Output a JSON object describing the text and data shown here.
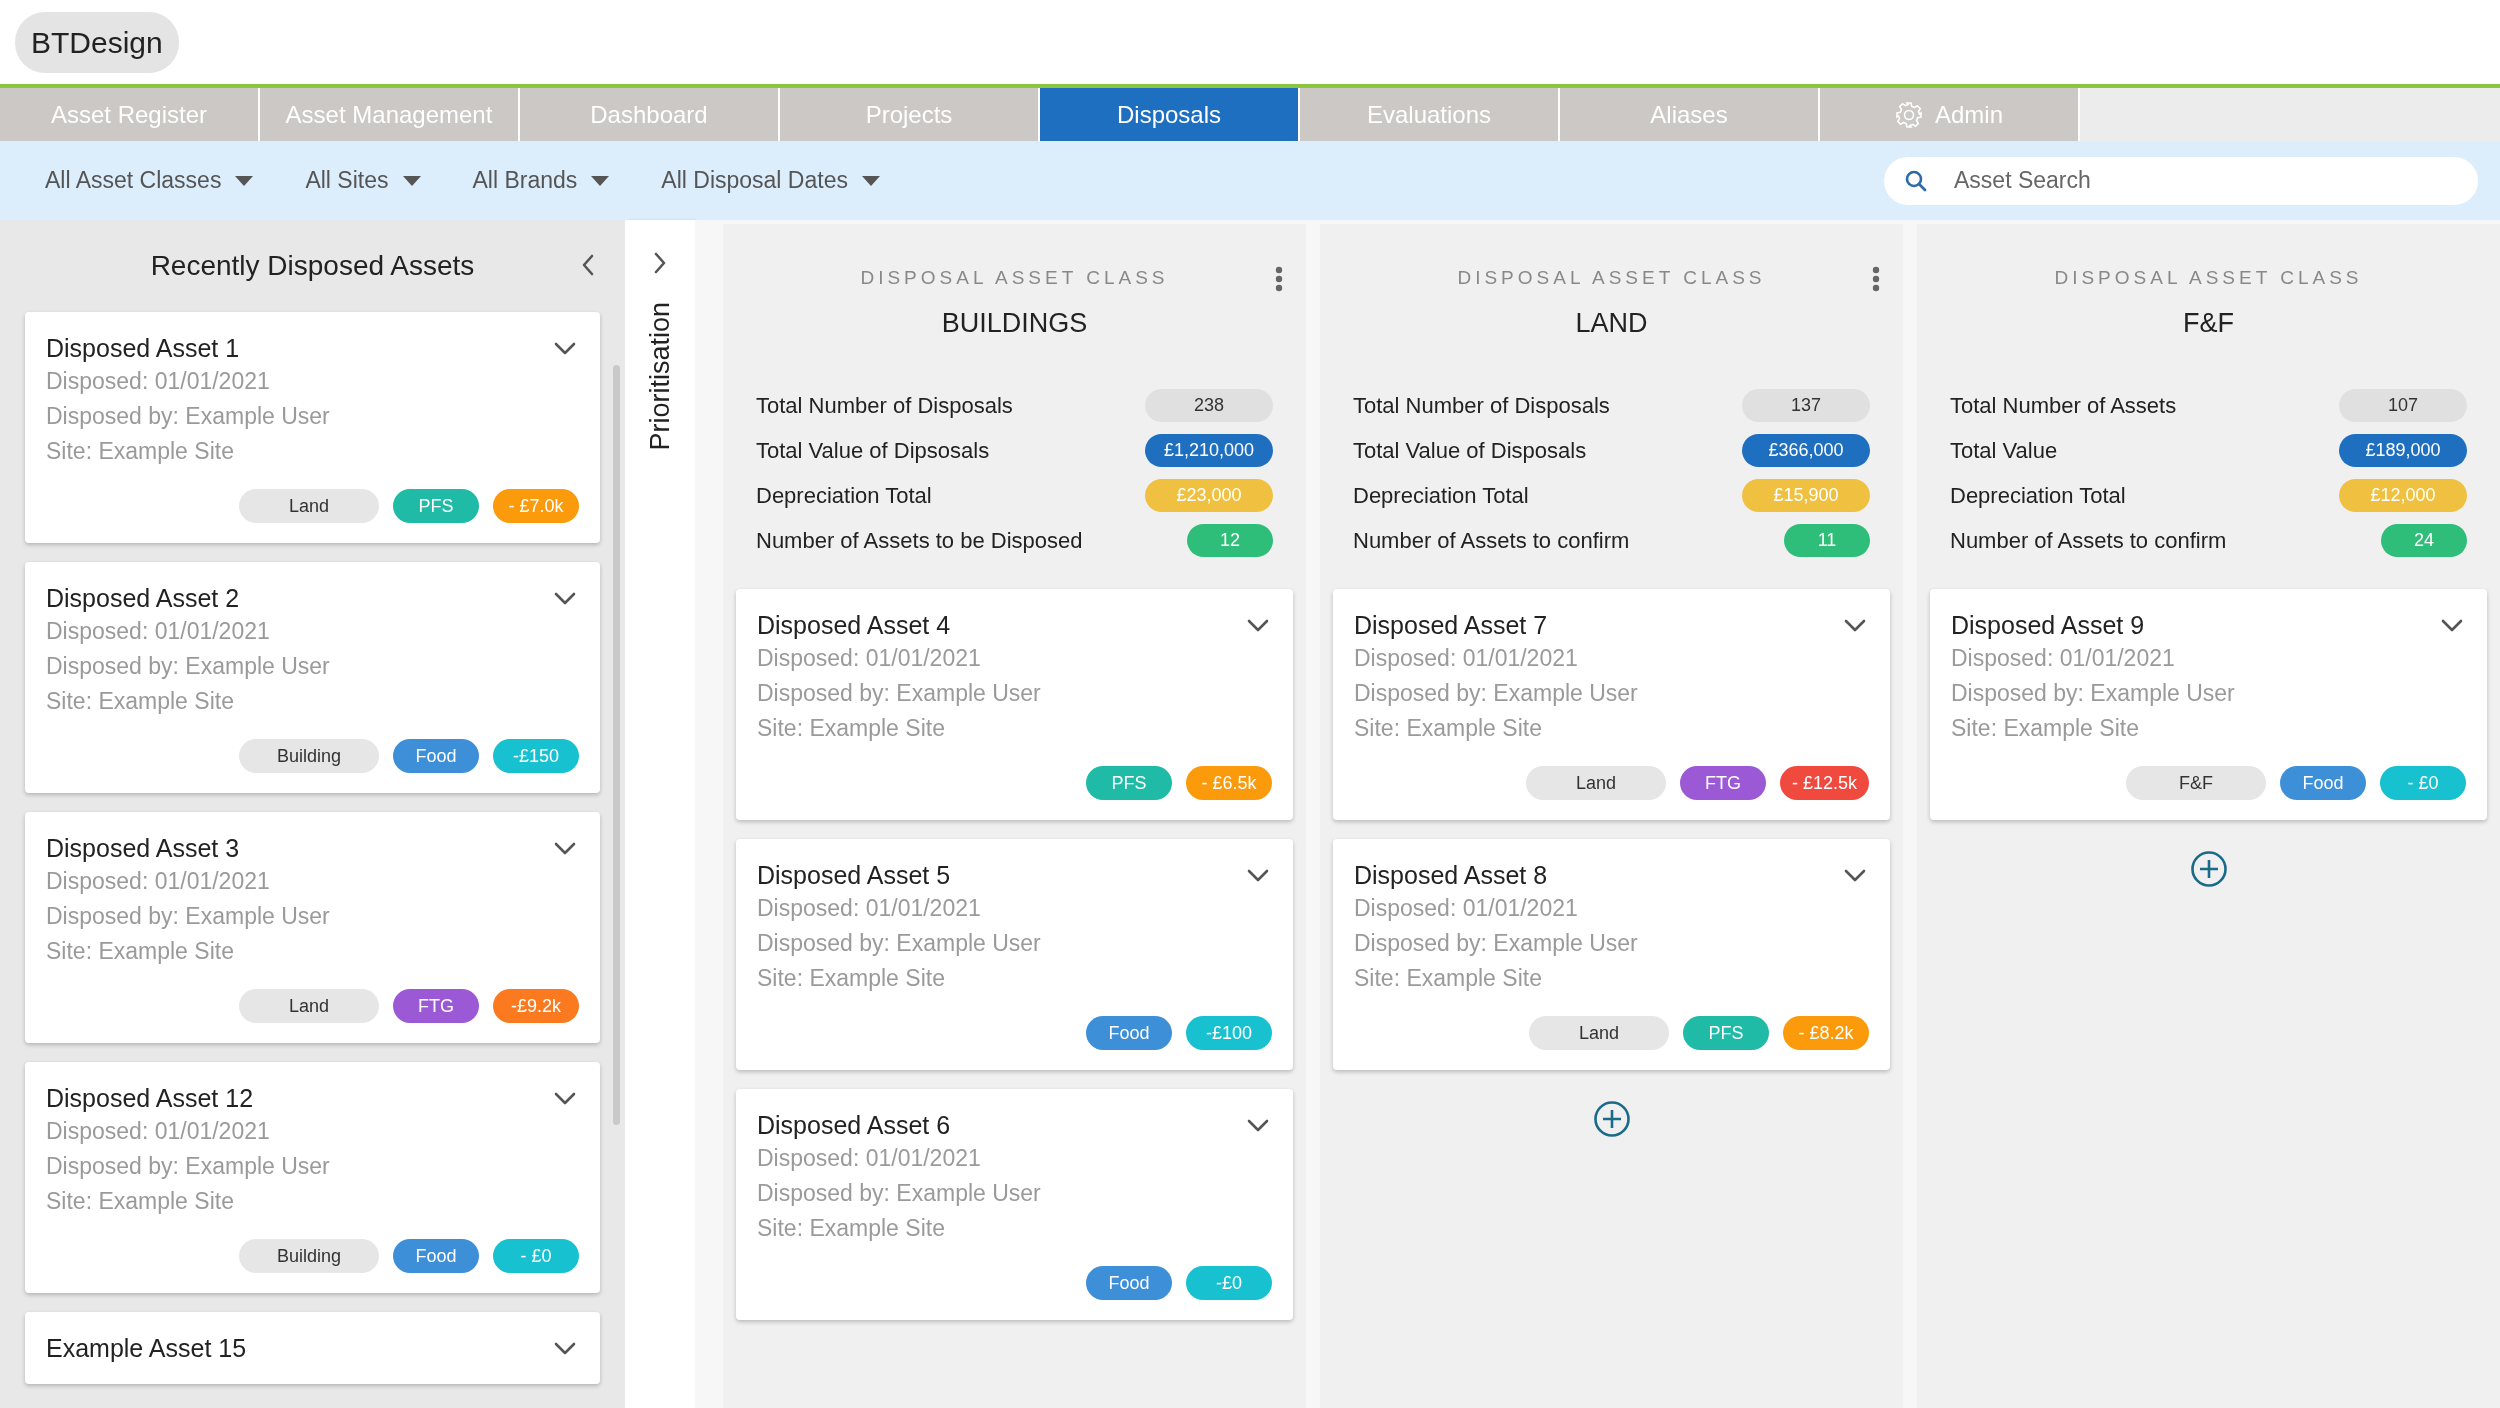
{
  "logo": "BTDesign",
  "tabs": [
    {
      "label": "Asset Register",
      "selected": false,
      "kind": "text"
    },
    {
      "label": "Asset Management",
      "selected": false,
      "kind": "text"
    },
    {
      "label": "Dashboard",
      "selected": false,
      "kind": "text"
    },
    {
      "label": "Projects",
      "selected": false,
      "kind": "text"
    },
    {
      "label": "Disposals",
      "selected": true,
      "kind": "text"
    },
    {
      "label": "Evaluations",
      "selected": false,
      "kind": "text"
    },
    {
      "label": "Aliases",
      "selected": false,
      "kind": "text"
    },
    {
      "label": "Admin",
      "selected": false,
      "kind": "settings"
    }
  ],
  "filters": [
    {
      "label": "All Asset Classes"
    },
    {
      "label": "All Sites"
    },
    {
      "label": "All Brands"
    },
    {
      "label": "All Disposal Dates"
    }
  ],
  "search": {
    "placeholder": "Asset Search"
  },
  "recent_panel": {
    "title": "Recently Disposed Assets",
    "assets": [
      {
        "title": "Disposed Asset 1",
        "lines": [
          "Disposed: 01/01/2021",
          "Disposed by: Example User",
          "Site: Example Site"
        ],
        "tags": [
          {
            "text": "Land",
            "color": "#e6e6e6"
          },
          {
            "text": "PFS",
            "color": "#1fbba6"
          },
          {
            "text": "- £7.0k",
            "color": "#fb9a0a"
          }
        ]
      },
      {
        "title": "Disposed Asset 2",
        "lines": [
          "Disposed: 01/01/2021",
          "Disposed by: Example User",
          "Site: Example Site"
        ],
        "tags": [
          {
            "text": "Building",
            "color": "#e6e6e6"
          },
          {
            "text": "Food",
            "color": "#3d8fd8"
          },
          {
            "text": "-£150",
            "color": "#17c1cf"
          }
        ]
      },
      {
        "title": "Disposed Asset 3",
        "lines": [
          "Disposed: 01/01/2021",
          "Disposed by: Example User",
          "Site: Example Site"
        ],
        "tags": [
          {
            "text": "Land",
            "color": "#e6e6e6"
          },
          {
            "text": "FTG",
            "color": "#9b59d6"
          },
          {
            "text": "-£9.2k",
            "color": "#fb7a1f"
          }
        ]
      },
      {
        "title": "Disposed Asset 12",
        "lines": [
          "Disposed: 01/01/2021",
          "Disposed by: Example User",
          "Site: Example Site"
        ],
        "tags": [
          {
            "text": "Building",
            "color": "#e6e6e6"
          },
          {
            "text": "Food",
            "color": "#3d8fd8"
          },
          {
            "text": "- £0",
            "color": "#17c1cf"
          }
        ]
      },
      {
        "title": "Example Asset 15"
      }
    ]
  },
  "side_strip": {
    "label": "Prioritisation"
  },
  "columns": [
    {
      "caption": "DISPOSAL ASSET CLASS",
      "title": "BUILDINGS",
      "has_menu": true,
      "show_add": false,
      "stats": [
        {
          "label": "Total Number of Disposals",
          "value": "238",
          "color": "#e0e0e0"
        },
        {
          "label": "Total Value of Dipsosals",
          "value": "£1,210,000",
          "color": "#1f6fc1"
        },
        {
          "label": "Depreciation Total",
          "value": "£23,000",
          "color": "#f0c040"
        },
        {
          "label": "Number of Assets to be Disposed",
          "value": "12",
          "color": "#2fbd7a"
        }
      ],
      "assets": [
        {
          "title": "Disposed Asset 4",
          "lines": [
            "Disposed: 01/01/2021",
            "Disposed by: Example User",
            "Site: Example Site"
          ],
          "tags": [
            {
              "text": "PFS",
              "color": "#1fbba6"
            },
            {
              "text": "- £6.5k",
              "color": "#fb9a0a"
            }
          ]
        },
        {
          "title": "Disposed Asset 5",
          "lines": [
            "Disposed: 01/01/2021",
            "Disposed by: Example User",
            "Site: Example Site"
          ],
          "tags": [
            {
              "text": "Food",
              "color": "#3d8fd8"
            },
            {
              "text": "-£100",
              "color": "#17c1cf"
            }
          ]
        },
        {
          "title": "Disposed Asset 6",
          "lines": [
            "Disposed: 01/01/2021",
            "Disposed by: Example User",
            "Site: Example Site"
          ],
          "tags": [
            {
              "text": "Food",
              "color": "#3d8fd8"
            },
            {
              "text": "-£0",
              "color": "#17c1cf"
            }
          ]
        }
      ]
    },
    {
      "caption": "DISPOSAL ASSET CLASS",
      "title": "LAND",
      "has_menu": true,
      "show_add": true,
      "stats": [
        {
          "label": "Total Number of Disposals",
          "value": "137",
          "color": "#e0e0e0"
        },
        {
          "label": "Total Value of Disposals",
          "value": "£366,000",
          "color": "#1f6fc1"
        },
        {
          "label": "Depreciation Total",
          "value": "£15,900",
          "color": "#f0c040"
        },
        {
          "label": "Number of Assets to confirm",
          "value": "11",
          "color": "#2fbd7a"
        }
      ],
      "assets": [
        {
          "title": "Disposed Asset 7",
          "lines": [
            "Disposed: 01/01/2021",
            "Disposed by: Example User",
            "Site: Example Site"
          ],
          "tags": [
            {
              "text": "Land",
              "color": "#e6e6e6"
            },
            {
              "text": "FTG",
              "color": "#9b59d6"
            },
            {
              "text": "- £12.5k",
              "color": "#f0493e"
            }
          ]
        },
        {
          "title": "Disposed Asset 8",
          "lines": [
            "Disposed: 01/01/2021",
            "Disposed by: Example User",
            "Site: Example Site"
          ],
          "tags": [
            {
              "text": "Land",
              "color": "#e6e6e6"
            },
            {
              "text": "PFS",
              "color": "#1fbba6"
            },
            {
              "text": "- £8.2k",
              "color": "#fb9a0a"
            }
          ]
        }
      ]
    },
    {
      "caption": "DISPOSAL ASSET CLASS",
      "title": "F&F",
      "has_menu": false,
      "show_add": true,
      "stats": [
        {
          "label": "Total Number of Assets",
          "value": "107",
          "color": "#e0e0e0"
        },
        {
          "label": "Total Value",
          "value": "£189,000",
          "color": "#1f6fc1"
        },
        {
          "label": "Depreciation Total",
          "value": "£12,000",
          "color": "#f0c040"
        },
        {
          "label": "Number of Assets to confirm",
          "value": "24",
          "color": "#2fbd7a"
        }
      ],
      "assets": [
        {
          "title": "Disposed Asset 9",
          "lines": [
            "Disposed: 01/01/2021",
            "Disposed by: Example User",
            "Site: Example Site"
          ],
          "tags": [
            {
              "text": "F&F",
              "color": "#e6e6e6"
            },
            {
              "text": "Food",
              "color": "#3d8fd8"
            },
            {
              "text": "- £0",
              "color": "#17c1cf"
            }
          ]
        }
      ]
    }
  ]
}
